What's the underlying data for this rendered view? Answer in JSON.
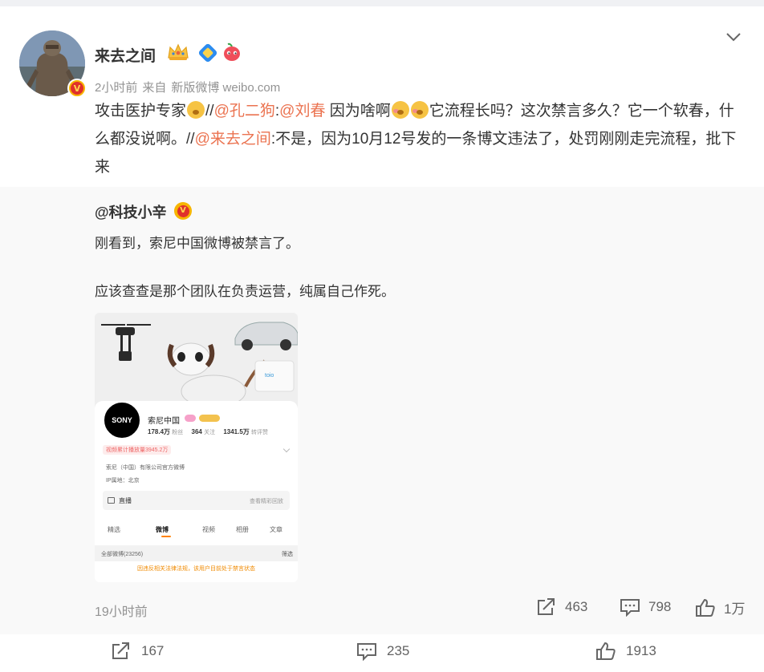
{
  "post": {
    "author": "来去之间",
    "avatar_badge": "V",
    "meta": {
      "time": "2小时前",
      "source_prefix": "来自",
      "source": "新版微博 weibo.com"
    },
    "text": {
      "t1": "攻击医护专家",
      "t2": "//",
      "m1": "@孔二狗",
      "t3": ":",
      "m2": "@刘春",
      "t4": " 因为啥啊",
      "t5": "它流程长吗？这次禁言多久？它一个软春，什么都没说啊。//",
      "m3": "@来去之间",
      "t6": ":不是，因为10月12号发的一条博文违法了，处罚刚刚走完流程，批下来"
    },
    "actions": {
      "share_count": "167",
      "comment_count": "235",
      "like_count": "1913"
    }
  },
  "repost": {
    "author": "@科技小辛",
    "author_badge": "V",
    "line1": "刚看到，索尼中国微博被禁言了。",
    "line2": "应该查查是那个团队在负责运营，纯属自己作死。",
    "time": "19小时前",
    "actions": {
      "share_count": "463",
      "comment_count": "798",
      "like_count": "1万"
    },
    "image": {
      "logo_text": "SONY",
      "name": "索尼中国",
      "followers": "178.4万",
      "followers_label": "粉丝",
      "following": "364",
      "following_label": "关注",
      "likes": "1341.5万",
      "likes_label": "转评赞",
      "views_tag": "视频累计播放量3945.2万",
      "verified": "索尼（中国）有限公司官方微博",
      "ip": "IP属地：北京",
      "live_label": "直播",
      "live_more": "查看精彩回放",
      "tabs": [
        "精选",
        "微博",
        "视频",
        "相册",
        "文章"
      ],
      "all_posts": "全部微博(23256)",
      "filter": "筛选",
      "warning": "因违反相关法律法规，该用户目前处于禁言状态"
    }
  }
}
